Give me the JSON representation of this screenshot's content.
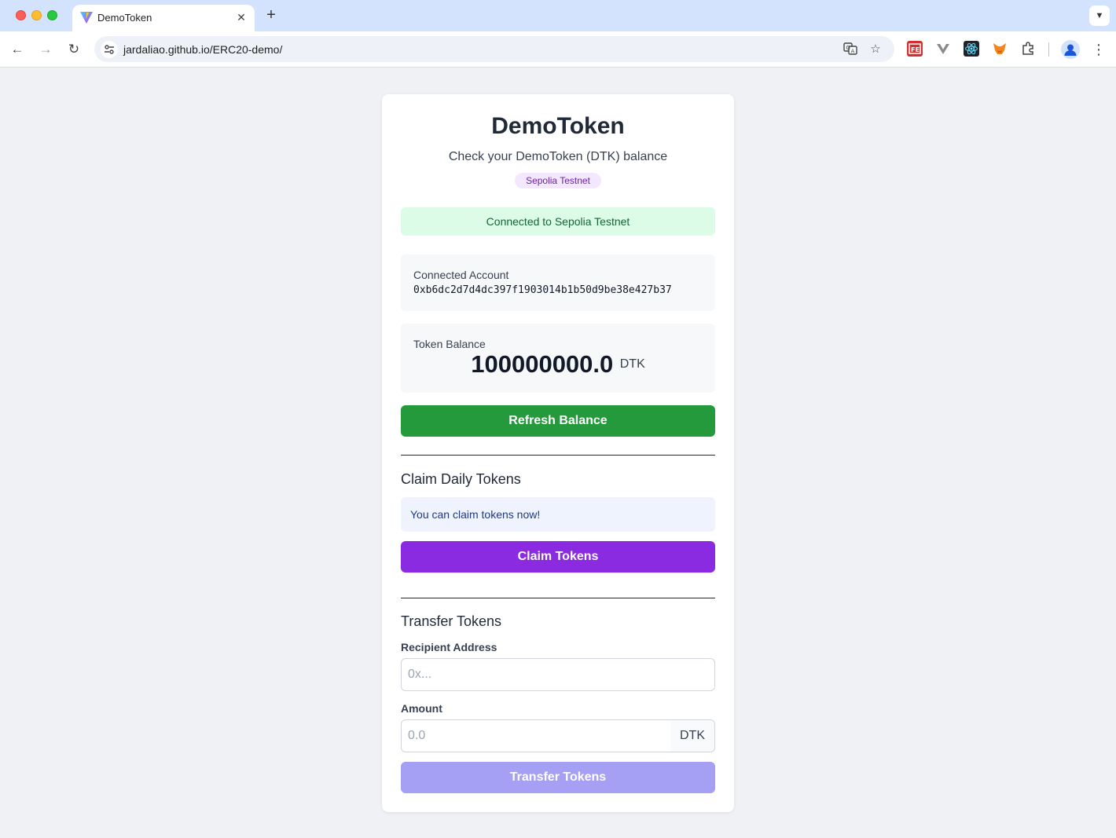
{
  "browser": {
    "tab_title": "DemoToken",
    "url": "jardaliao.github.io/ERC20-demo/",
    "icons": [
      "back-icon",
      "forward-icon",
      "reload-icon",
      "site-info-icon",
      "translate-icon",
      "star-icon",
      "extensions-icon",
      "profile-icon",
      "kebab-menu-icon"
    ]
  },
  "page": {
    "title": "DemoToken",
    "subtitle": "Check your DemoToken (DTK) balance",
    "network_badge": "Sepolia Testnet",
    "status": "Connected to Sepolia Testnet"
  },
  "account": {
    "label": "Connected Account",
    "address": "0xb6dc2d7d4dc397f1903014b1b50d9be38e427b37"
  },
  "balance": {
    "label": "Token Balance",
    "value": "100000000.0",
    "unit": "DTK"
  },
  "actions": {
    "refresh_label": "Refresh Balance"
  },
  "claim": {
    "title": "Claim Daily Tokens",
    "info": "You can claim tokens now!",
    "button_label": "Claim Tokens"
  },
  "transfer": {
    "title": "Transfer Tokens",
    "recipient_label": "Recipient Address",
    "recipient_placeholder": "0x...",
    "amount_label": "Amount",
    "amount_placeholder": "0.0",
    "amount_unit": "DTK",
    "button_label": "Transfer Tokens"
  },
  "colors": {
    "refresh_button": "#259a3c",
    "claim_button": "#8a2be2",
    "transfer_button_disabled": "#a5a0f3",
    "status_bg": "#dcfce7",
    "badge_bg": "#f3e8ff"
  }
}
